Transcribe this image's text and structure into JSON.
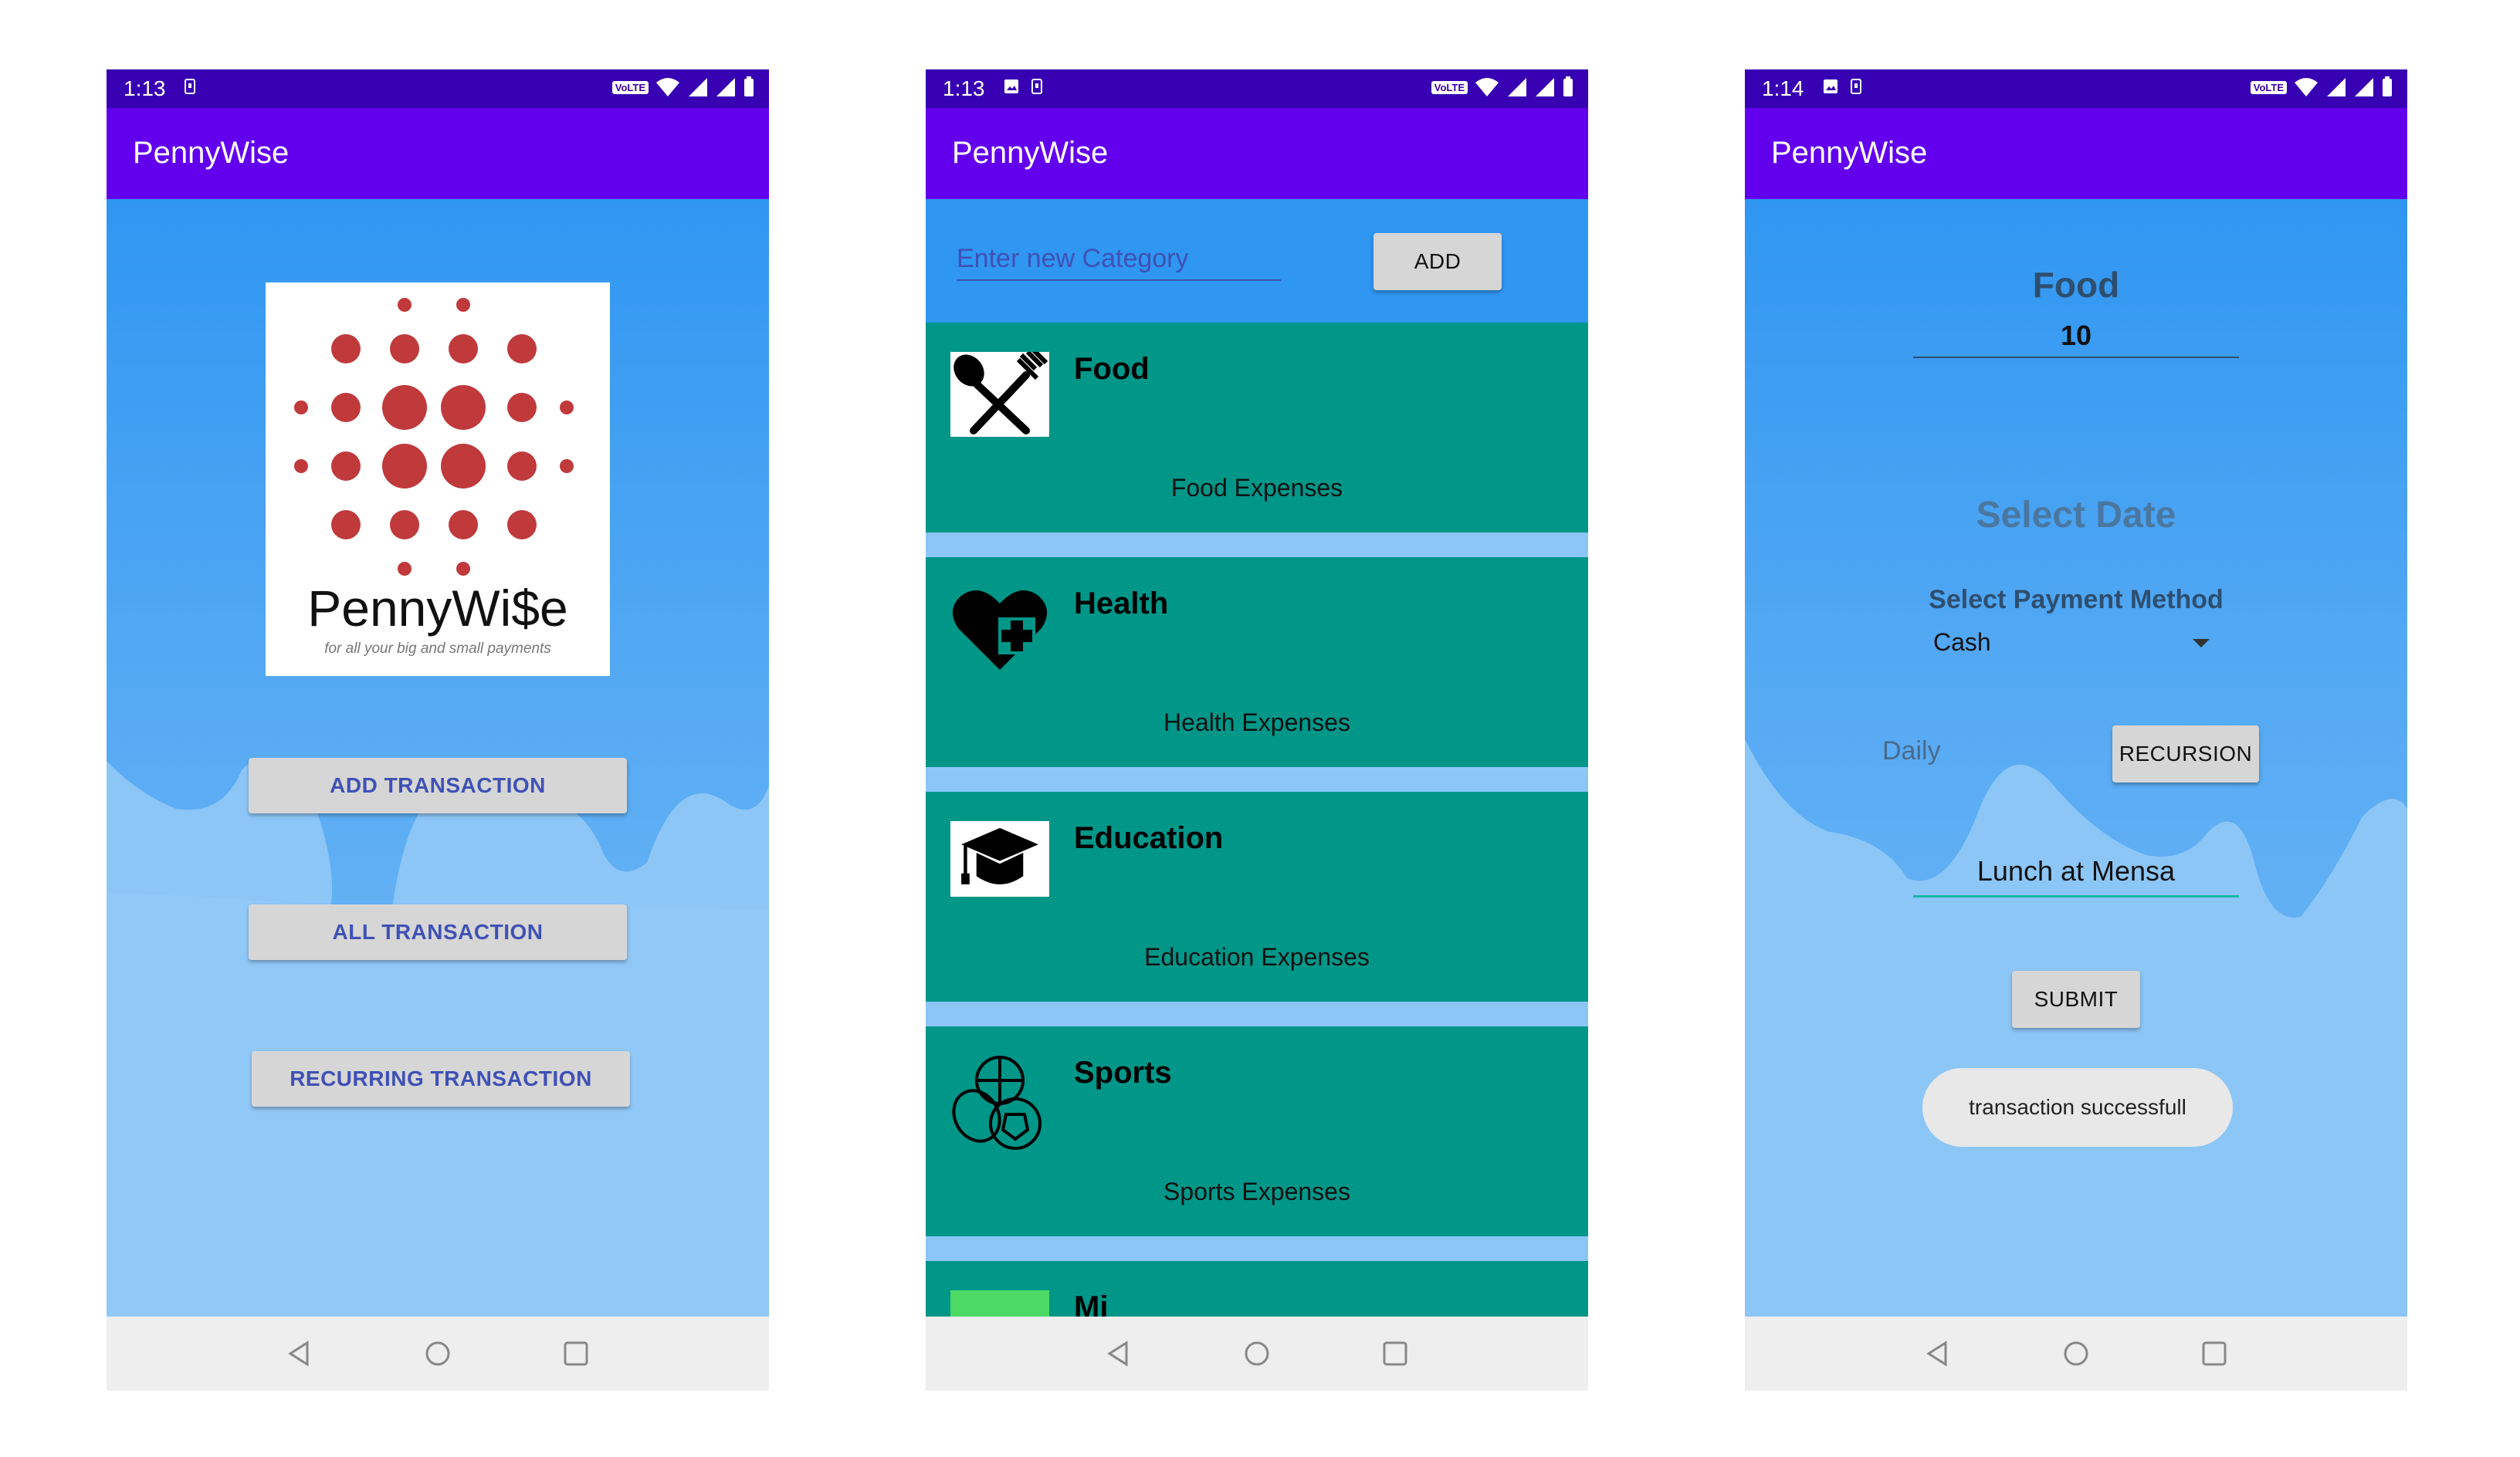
{
  "screens": {
    "home": {
      "status_time": "1:13",
      "app_title": "PennyWise",
      "logo": {
        "brand": "PennyWi$e",
        "tagline": "for all your big and small payments"
      },
      "buttons": {
        "add": "ADD TRANSACTION",
        "all": "ALL TRANSACTION",
        "recurring": "RECURRING TRANSACTION"
      }
    },
    "categories": {
      "status_time": "1:13",
      "app_title": "PennyWise",
      "input_placeholder": "Enter new Category",
      "add_button": "ADD",
      "items": [
        {
          "title": "Food",
          "subtitle": "Food Expenses",
          "icon": "fork-spoon-icon"
        },
        {
          "title": "Health",
          "subtitle": "Health Expenses",
          "icon": "heart-plus-icon"
        },
        {
          "title": "Education",
          "subtitle": "Education Expenses",
          "icon": "graduation-cap-icon"
        },
        {
          "title": "Sports",
          "subtitle": "Sports Expenses",
          "icon": "balls-icon"
        }
      ],
      "partial_item_title": "Mi"
    },
    "transaction": {
      "status_time": "1:14",
      "app_title": "PennyWise",
      "category": "Food",
      "amount": "10",
      "select_date": "Select Date",
      "payment_label": "Select Payment Method",
      "payment_value": "Cash",
      "recurrence_value": "Daily",
      "recursion_button": "RECURSION",
      "note": "Lunch at Mensa",
      "submit_button": "SUBMIT",
      "toast": "transaction successfull"
    }
  },
  "colors": {
    "status_bar": "#3700b3",
    "app_bar": "#6200ee",
    "card": "#009688",
    "logo_red": "#c0393b",
    "button_text": "#3f51b5"
  }
}
